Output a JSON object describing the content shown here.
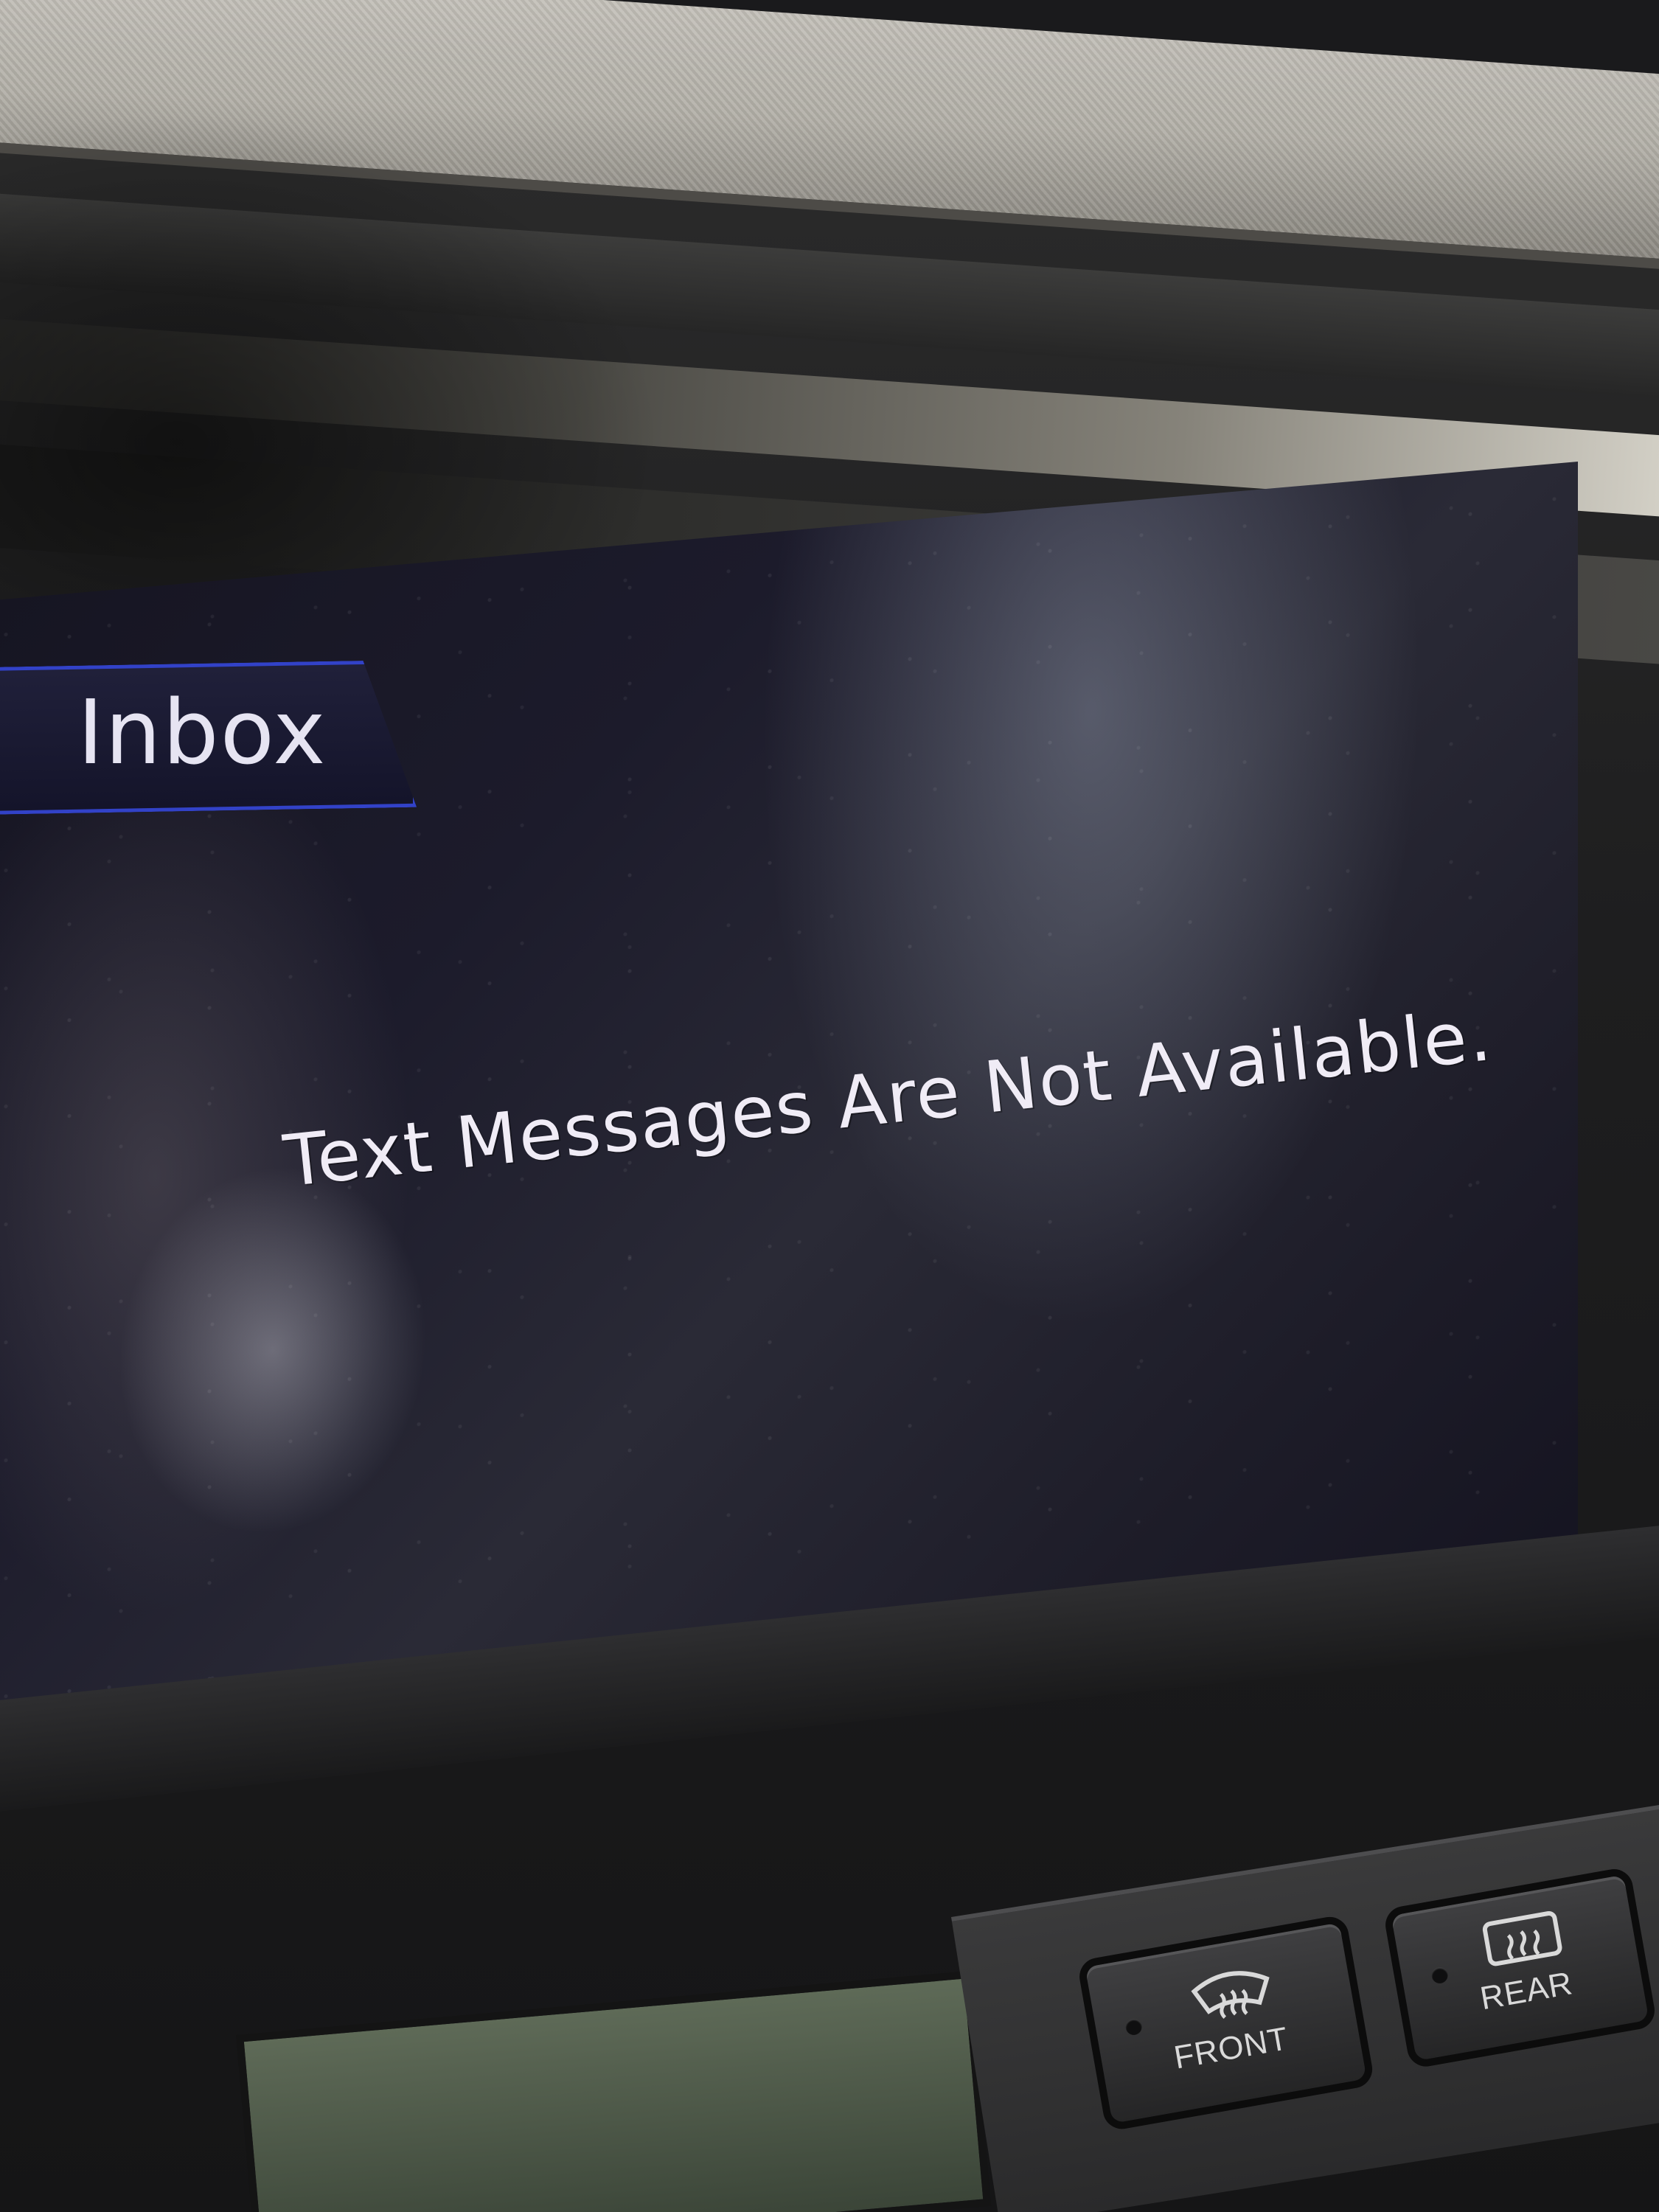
{
  "screen": {
    "tab_label": "Inbox",
    "message": "Text Messages Are Not Available.",
    "tab_border_color": "#3242c8",
    "text_color": "#f0ecf6"
  },
  "controls": {
    "front_defrost": {
      "label": "FRONT",
      "icon": "windshield-defrost-icon"
    },
    "rear_defrost": {
      "label": "REAR",
      "icon": "rear-window-defrost-icon"
    }
  }
}
